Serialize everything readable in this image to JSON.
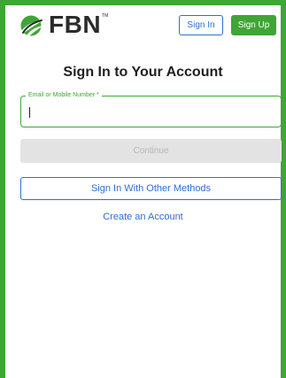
{
  "brand": {
    "name": "FBN",
    "trademark": "TM",
    "accent_color": "#3fa535",
    "link_color": "#2d6fd0"
  },
  "header": {
    "sign_in_label": "Sign In",
    "sign_up_label": "Sign Up"
  },
  "form": {
    "title": "Sign In to Your Account",
    "email_label": "Email or Mobile Number *",
    "email_value": "",
    "continue_label": "Continue",
    "other_methods_label": "Sign In With Other Methods",
    "create_account_label": "Create an Account"
  },
  "icons": {
    "logo": "fbn-leaf-logo-icon"
  }
}
